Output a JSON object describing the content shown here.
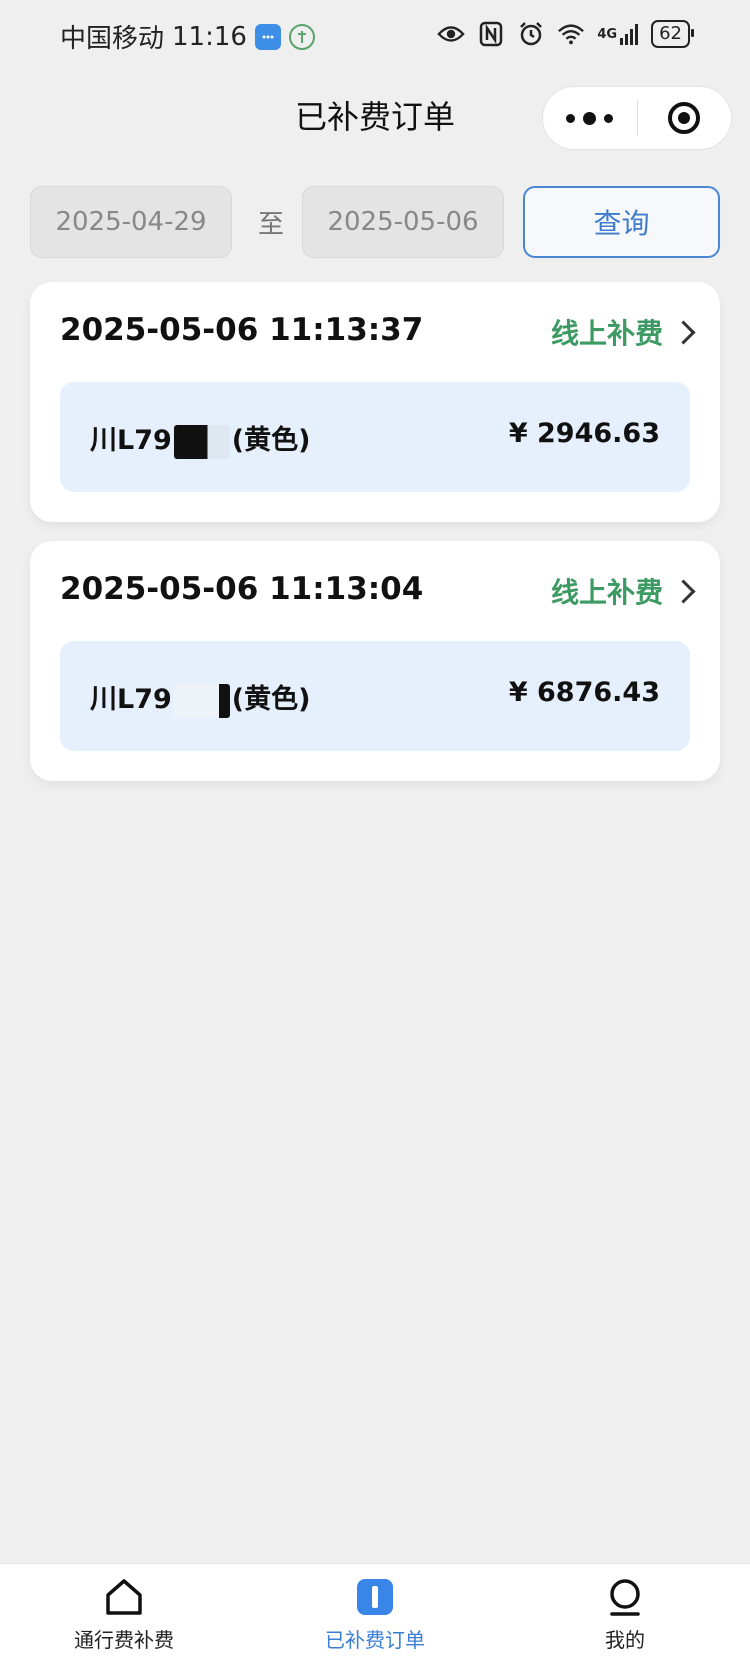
{
  "status_bar": {
    "carrier": "中国移动",
    "time": "11:16",
    "network": "4G",
    "battery": "62"
  },
  "nav": {
    "title": "已补费订单"
  },
  "filter": {
    "start_date": "2025-04-29",
    "separator": "至",
    "end_date": "2025-05-06",
    "query_label": "查询"
  },
  "orders": [
    {
      "time": "2025-05-06 11:13:37",
      "type": "线上补费",
      "plate_prefix": "川L79",
      "plate_suffix": "(黄色)",
      "amount": "¥ 2946.63"
    },
    {
      "time": "2025-05-06 11:13:04",
      "type": "线上补费",
      "plate_prefix": "川L79",
      "plate_suffix": "(黄色)",
      "amount": "¥ 6876.43"
    }
  ],
  "tabbar": {
    "tabs": [
      {
        "label": "通行费补费",
        "icon": "home-icon"
      },
      {
        "label": "已补费订单",
        "icon": "order-icon",
        "active": true
      },
      {
        "label": "我的",
        "icon": "profile-icon"
      }
    ]
  },
  "colors": {
    "accent_blue": "#3f7ccb",
    "green": "#3c9a62",
    "vehicle_bg": "#e6f0fc",
    "page_bg": "#efefef"
  }
}
